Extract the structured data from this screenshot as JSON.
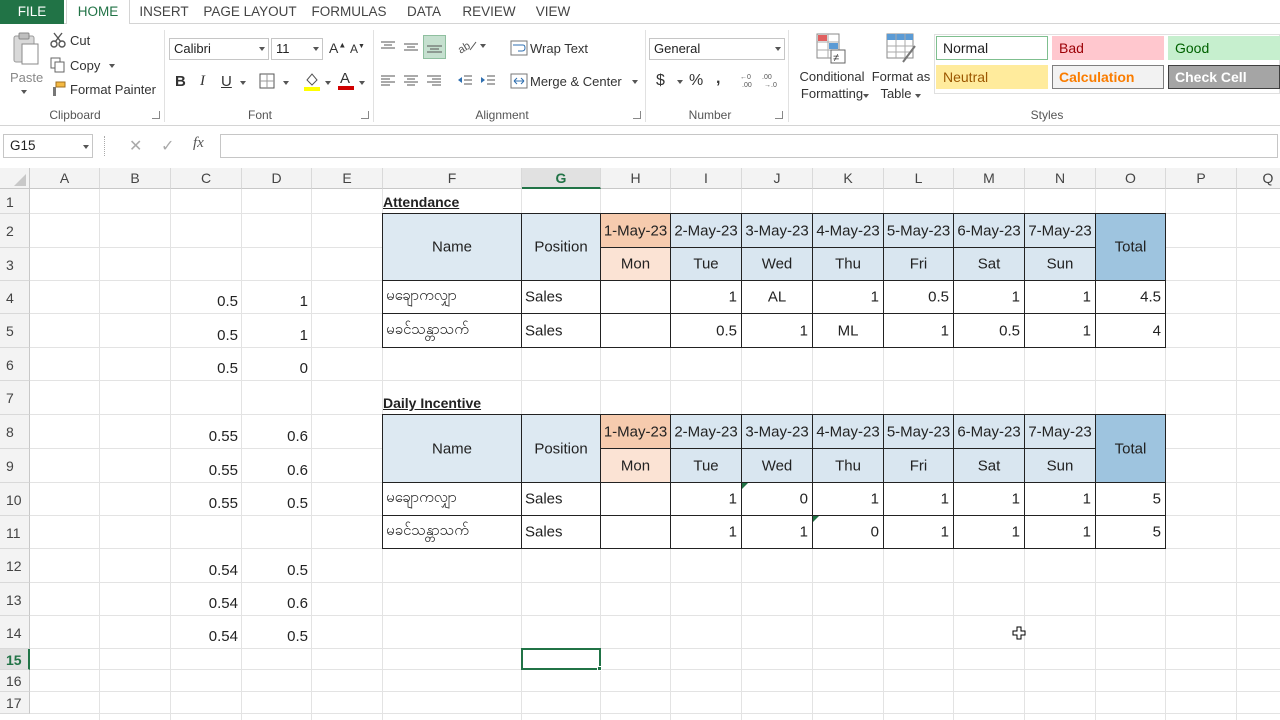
{
  "ribbon_tabs": [
    "FILE",
    "HOME",
    "INSERT",
    "PAGE LAYOUT",
    "FORMULAS",
    "DATA",
    "REVIEW",
    "VIEW"
  ],
  "clipboard": {
    "paste": "Paste",
    "cut": "Cut",
    "copy": "Copy",
    "format_painter": "Format Painter",
    "label": "Clipboard"
  },
  "font": {
    "name": "Calibri",
    "size": "11",
    "label": "Font",
    "bold": "B",
    "italic": "I",
    "underline": "U"
  },
  "alignment": {
    "wrap_text": "Wrap Text",
    "merge_center": "Merge & Center",
    "label": "Alignment"
  },
  "number": {
    "format": "General",
    "currency": "$",
    "percent": "%",
    "comma": ",",
    "label": "Number"
  },
  "styles": {
    "conditional_formatting_1": "Conditional",
    "conditional_formatting_2": "Formatting",
    "format_as_table_1": "Format as",
    "format_as_table_2": "Table",
    "label": "Styles",
    "cells": [
      {
        "name": "Normal",
        "bg": "#ffffff",
        "fg": "#222222",
        "border": "#7fbf8f"
      },
      {
        "name": "Bad",
        "bg": "#ffc7ce",
        "fg": "#9c0006",
        "border": "#ffc7ce"
      },
      {
        "name": "Good",
        "bg": "#c6efce",
        "fg": "#006100",
        "border": "#c6efce"
      },
      {
        "name": "Neutral",
        "bg": "#ffeb9c",
        "fg": "#9c5700",
        "border": "#ffeb9c"
      },
      {
        "name": "Calculation",
        "bg": "#f2f2f2",
        "fg": "#fa7d00",
        "border": "#7f7f7f"
      },
      {
        "name": "Check Cell",
        "bg": "#a5a5a5",
        "fg": "#ffffff",
        "border": "#3f3f3f"
      }
    ]
  },
  "formula_bar": {
    "name_box": "G15",
    "cancel": "✕",
    "enter": "✓",
    "fx": "fx",
    "formula": ""
  },
  "columns": [
    "A",
    "B",
    "C",
    "D",
    "E",
    "F",
    "G",
    "H",
    "I",
    "J",
    "K",
    "L",
    "M",
    "N",
    "O",
    "P",
    "Q"
  ],
  "selected_column": "G",
  "rows": [
    "1",
    "2",
    "3",
    "4",
    "5",
    "6",
    "7",
    "8",
    "9",
    "10",
    "11",
    "12",
    "13",
    "14",
    "15",
    "16",
    "17"
  ],
  "selected_row": "15",
  "side_values": {
    "C4": "0.5",
    "D4": "1",
    "C5": "0.5",
    "D5": "1",
    "C6": "0.5",
    "D6": "0",
    "C8": "0.55",
    "D8": "0.6",
    "C9": "0.55",
    "D9": "0.6",
    "C10": "0.55",
    "D10": "0.5",
    "C12": "0.54",
    "D12": "0.5",
    "C13": "0.54",
    "D13": "0.6",
    "C14": "0.54",
    "D14": "0.5"
  },
  "attendance": {
    "title": "Attendance",
    "name_header": "Name",
    "position_header": "Position",
    "total_header": "Total",
    "dates": [
      "1-May-23",
      "2-May-23",
      "3-May-23",
      "4-May-23",
      "5-May-23",
      "6-May-23",
      "7-May-23"
    ],
    "days": [
      "Mon",
      "Tue",
      "Wed",
      "Thu",
      "Fri",
      "Sat",
      "Sun"
    ],
    "rows": [
      {
        "name": "မချောကလျှာ",
        "position": "Sales",
        "values": [
          "",
          "1",
          "AL",
          "1",
          "0.5",
          "1",
          "1"
        ],
        "total": "4.5"
      },
      {
        "name": "မခင်သန္တာသက်",
        "position": "Sales",
        "values": [
          "",
          "0.5",
          "1",
          "ML",
          "1",
          "0.5",
          "1"
        ],
        "total": "4"
      }
    ]
  },
  "incentive": {
    "title": "Daily Incentive",
    "name_header": "Name",
    "position_header": "Position",
    "total_header": "Total",
    "dates": [
      "1-May-23",
      "2-May-23",
      "3-May-23",
      "4-May-23",
      "5-May-23",
      "6-May-23",
      "7-May-23"
    ],
    "days": [
      "Mon",
      "Tue",
      "Wed",
      "Thu",
      "Fri",
      "Sat",
      "Sun"
    ],
    "rows": [
      {
        "name": "မချောကလျှာ",
        "position": "Sales",
        "values": [
          "",
          "1",
          "0",
          "1",
          "1",
          "1",
          "1"
        ],
        "total": "5"
      },
      {
        "name": "မခင်သန္တာသက်",
        "position": "Sales",
        "values": [
          "",
          "1",
          "1",
          "0",
          "1",
          "1",
          "1"
        ],
        "total": "5"
      }
    ]
  }
}
